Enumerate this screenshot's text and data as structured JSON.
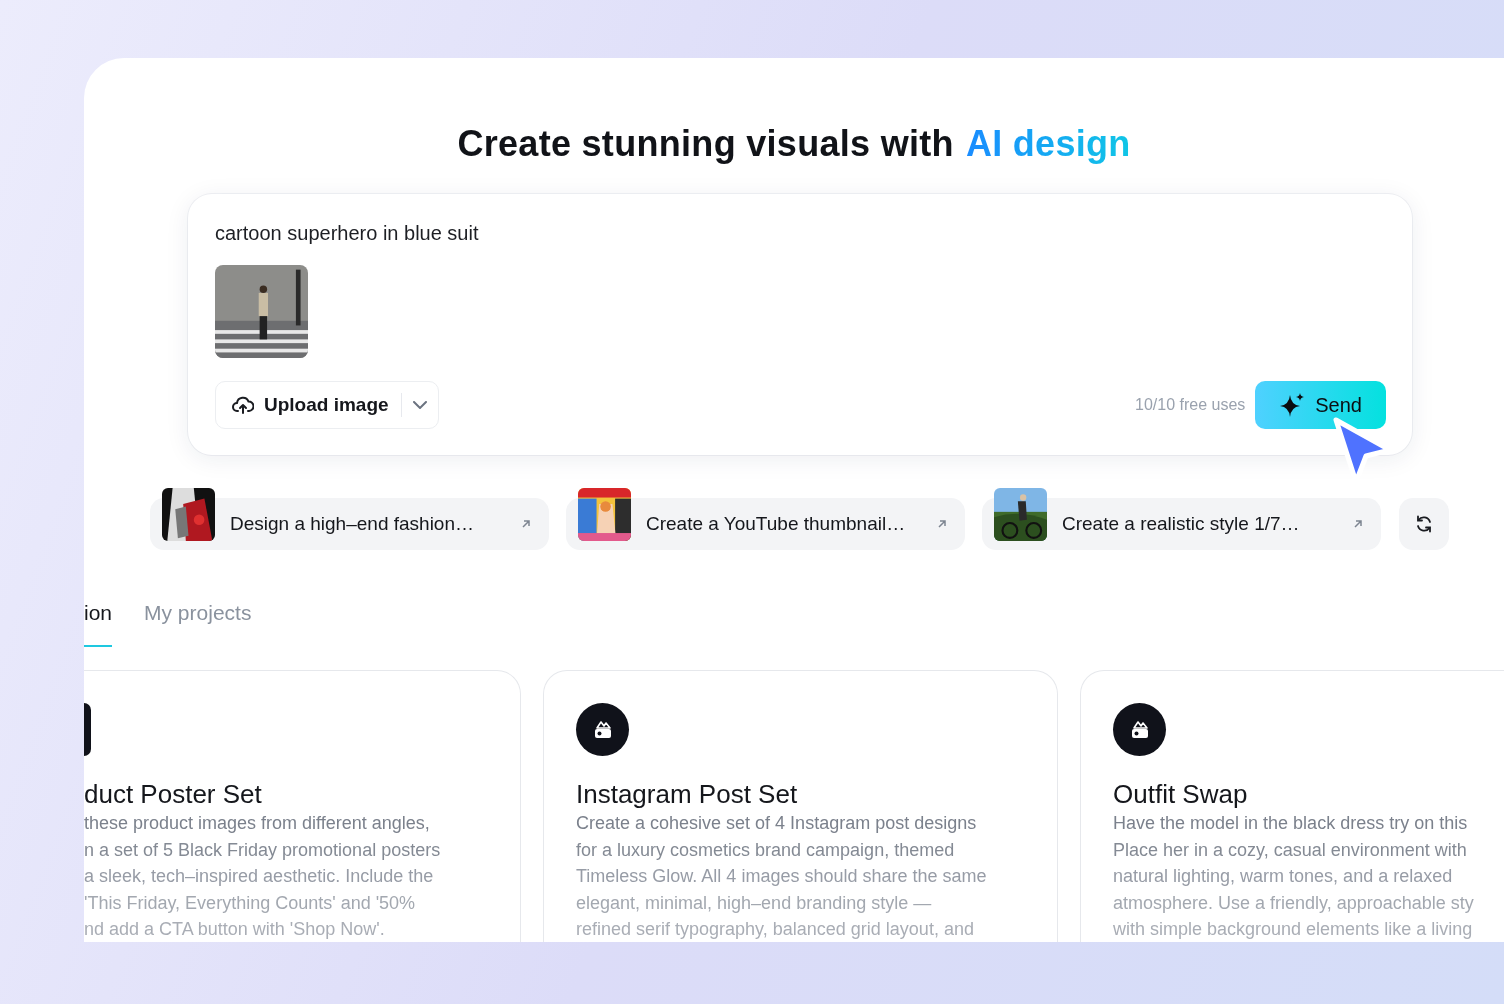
{
  "heading": {
    "text": "Create stunning visuals with",
    "highlight": "AI design"
  },
  "prompt": {
    "value": "cartoon superhero in blue suit",
    "upload_button": "Upload image",
    "usage": "10/10 free uses",
    "send_button": "Send"
  },
  "suggestions": [
    {
      "label": "Design a high–end fashion…"
    },
    {
      "label": "Create a YouTube thumbnail…"
    },
    {
      "label": "Create a realistic style 1/7…"
    }
  ],
  "tabs": [
    {
      "label": "ion",
      "selected": true
    },
    {
      "label": "My projects",
      "selected": false
    }
  ],
  "cards": [
    {
      "title": "duct Poster Set",
      "description_lines": [
        "these product images from different angles,",
        "n a set of 5 Black Friday promotional posters",
        "a sleek, tech–inspired aesthetic. Include the",
        "'This Friday, Everything Counts' and '50%",
        "nd add a CTA button with 'Shop Now'."
      ]
    },
    {
      "title": "Instagram Post Set",
      "description_lines": [
        "Create a cohesive set of 4 Instagram post designs",
        "for a luxury cosmetics brand campaign, themed",
        "Timeless Glow. All 4 images should share the same",
        "elegant, minimal, high–end branding style —",
        "refined serif typography, balanced grid layout, and"
      ]
    },
    {
      "title": "Outfit Swap",
      "description_lines": [
        "Have the model in the black dress try on this",
        "Place her in a cozy, casual environment with",
        "natural lighting, warm tones, and a relaxed",
        "atmosphere. Use a friendly, approachable sty",
        "with simple background elements like a living"
      ]
    }
  ]
}
